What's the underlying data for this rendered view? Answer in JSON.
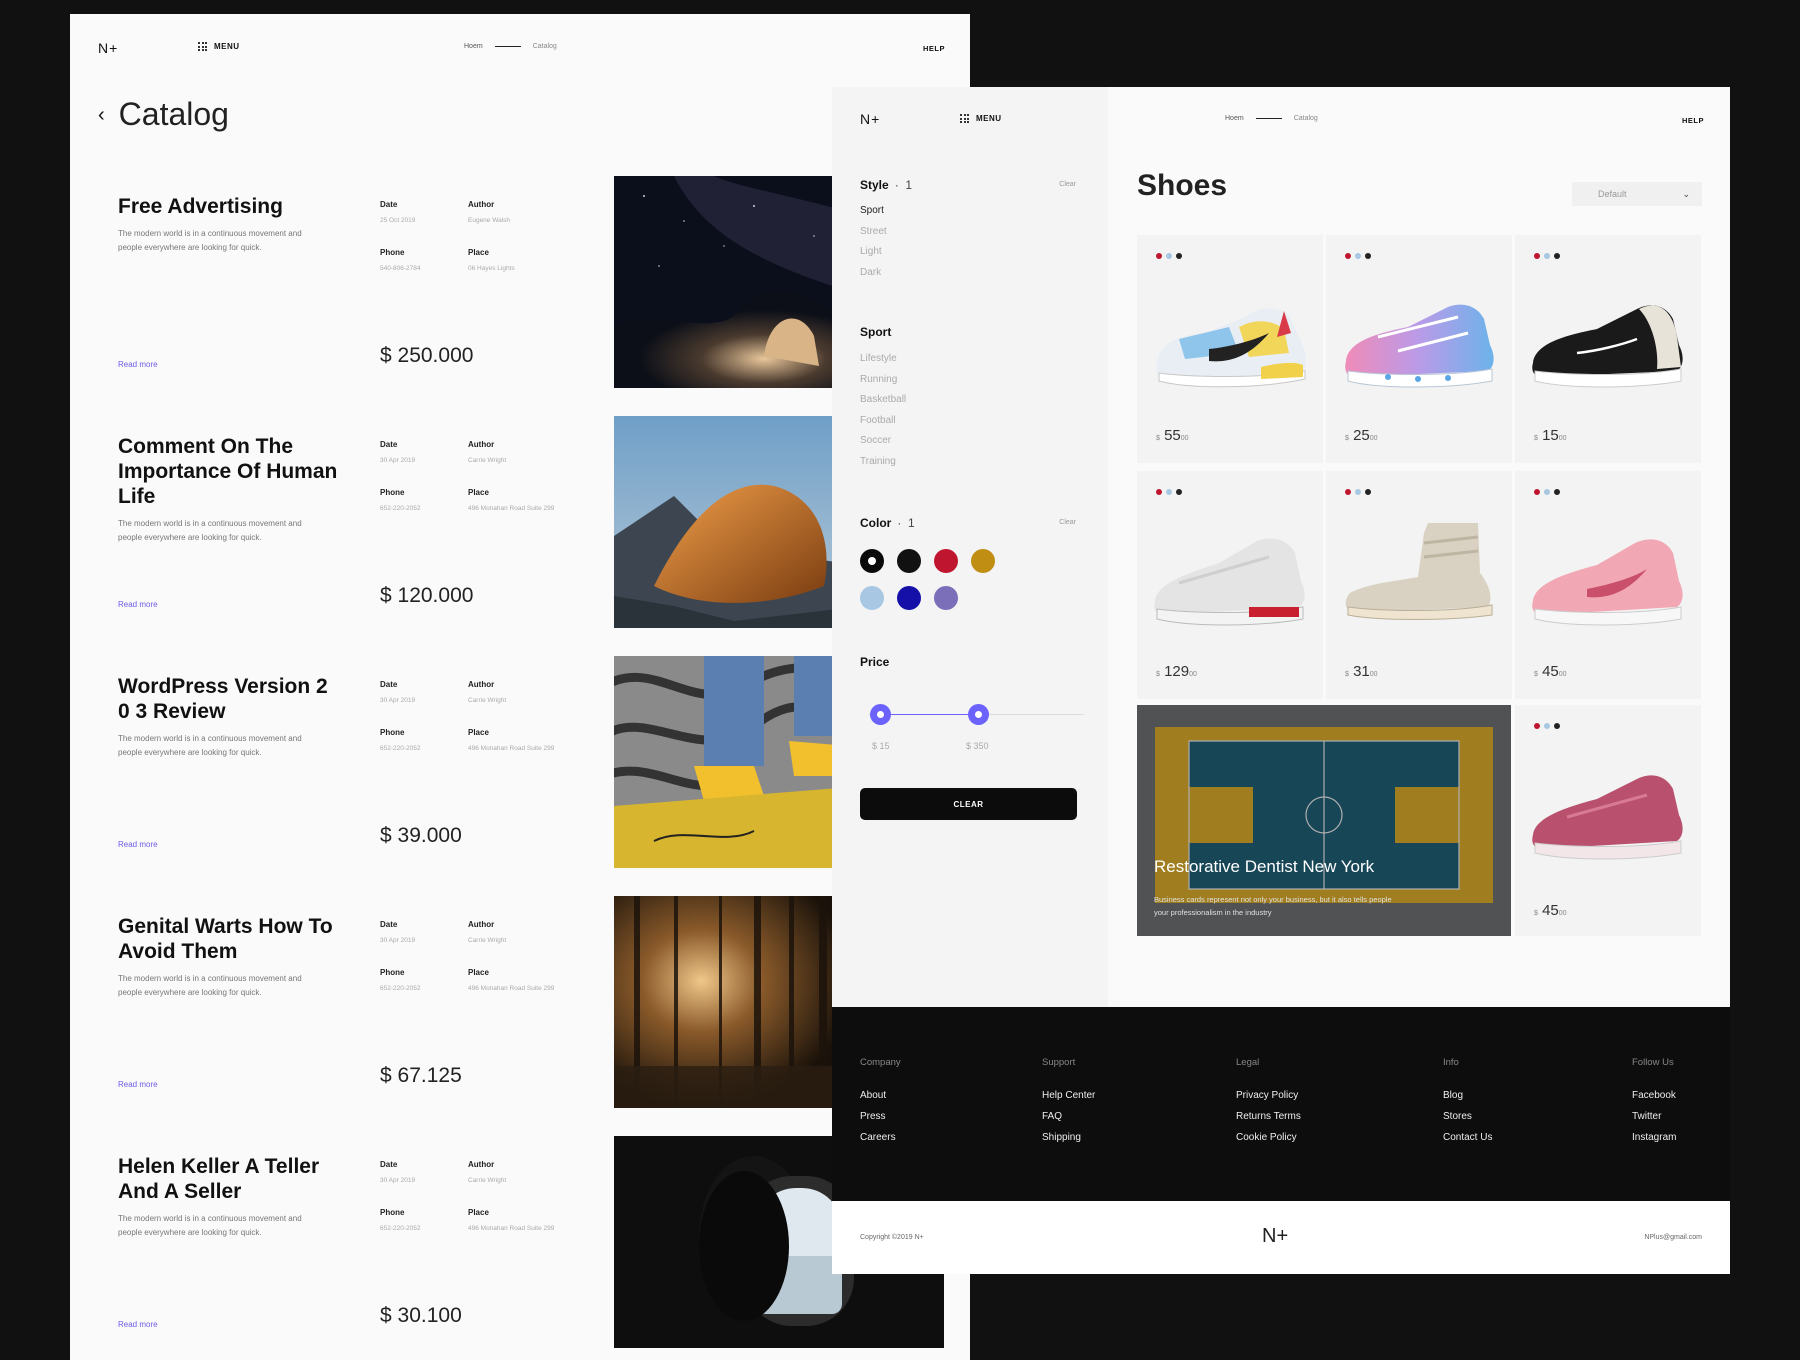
{
  "catalog": {
    "logo": "N+",
    "menu_label": "MENU",
    "breadcrumb": [
      "Hoem",
      "Catalog"
    ],
    "help": "HELP",
    "title": "Catalog",
    "items": [
      {
        "title": "Free Advertising",
        "desc": "The modern world is in a continuous movement and people everywhere are looking for quick.",
        "date_label": "Date",
        "date": "25 Oct 2019",
        "author_label": "Author",
        "author": "Eugene Walsh",
        "phone_label": "Phone",
        "phone": "540-806-2784",
        "place_label": "Place",
        "place": "06 Hayes Lights",
        "read_more": "Read more",
        "price": "$ 250.000"
      },
      {
        "title": "Comment On The Importance Of Human Life",
        "desc": "The modern world is in a continuous movement and people everywhere are looking for quick.",
        "date_label": "Date",
        "date": "30 Apr 2019",
        "author_label": "Author",
        "author": "Carrie Wright",
        "phone_label": "Phone",
        "phone": "652-220-2052",
        "place_label": "Place",
        "place": "496 Monahan Road Suite 299",
        "read_more": "Read more",
        "price": "$ 120.000"
      },
      {
        "title": "WordPress Version 2 0 3 Review",
        "desc": "The modern world is in a continuous movement and people everywhere are looking for quick.",
        "date_label": "Date",
        "date": "30 Apr 2019",
        "author_label": "Author",
        "author": "Carrie Wright",
        "phone_label": "Phone",
        "phone": "652-220-2052",
        "place_label": "Place",
        "place": "496 Monahan Road Suite 299",
        "read_more": "Read more",
        "price": "$ 39.000"
      },
      {
        "title": "Genital Warts How To Avoid Them",
        "desc": "The modern world is in a continuous movement and people everywhere are looking for quick.",
        "date_label": "Date",
        "date": "30 Apr 2019",
        "author_label": "Author",
        "author": "Carrie Wright",
        "phone_label": "Phone",
        "phone": "652-220-2052",
        "place_label": "Place",
        "place": "496 Monahan Road Suite 299",
        "read_more": "Read more",
        "price": "$ 67.125"
      },
      {
        "title": "Helen Keller A Teller And A Seller",
        "desc": "The modern world is in a continuous movement and people everywhere are looking for quick.",
        "date_label": "Date",
        "date": "30 Apr 2019",
        "author_label": "Author",
        "author": "Carrie Wright",
        "phone_label": "Phone",
        "phone": "652-220-2052",
        "place_label": "Place",
        "place": "496 Monahan Road Suite 299",
        "read_more": "Read more",
        "price": "$ 30.100"
      }
    ]
  },
  "shoes": {
    "logo": "N+",
    "menu_label": "MENU",
    "breadcrumb": [
      "Hoem",
      "Catalog"
    ],
    "help": "HELP",
    "title": "Shoes",
    "sort_value": "Default",
    "filters": {
      "style": {
        "label": "Style",
        "count": "1",
        "clear": "Clear",
        "options": [
          "Sport",
          "Street",
          "Light",
          "Dark"
        ],
        "active": "Sport"
      },
      "sport": {
        "label": "Sport",
        "options": [
          "Lifestyle",
          "Running",
          "Basketball",
          "Football",
          "Soccer",
          "Training"
        ]
      },
      "color": {
        "label": "Color",
        "count": "1",
        "clear": "Clear",
        "swatches": [
          "#0a0a0a",
          "#111111",
          "#c0152f",
          "#c08e12",
          "#a7c7e3",
          "#1410a8",
          "#7a6fb8"
        ],
        "selected": "#0a0a0a"
      },
      "price": {
        "label": "Price",
        "min": "$ 15",
        "max": "$ 350",
        "clear_label": "CLEAR"
      }
    },
    "products": [
      {
        "whole": "55",
        "cents": "00",
        "currency": "$"
      },
      {
        "whole": "25",
        "cents": "00",
        "currency": "$"
      },
      {
        "whole": "15",
        "cents": "00",
        "currency": "$"
      },
      {
        "whole": "129",
        "cents": "00",
        "currency": "$"
      },
      {
        "whole": "31",
        "cents": "00",
        "currency": "$"
      },
      {
        "whole": "45",
        "cents": "00",
        "currency": "$"
      },
      {
        "whole": "45",
        "cents": "00",
        "currency": "$"
      }
    ],
    "product_dot_colors": [
      "#c0152f",
      "#a7c7e3",
      "#222222"
    ],
    "promo": {
      "title": "Restorative Dentist New York",
      "text": "Business cards represent not only your business, but it also tells people your professionalism in the industry"
    },
    "footer": {
      "columns": [
        {
          "heading": "Company",
          "links": [
            "About",
            "Press",
            "Careers"
          ]
        },
        {
          "heading": "Support",
          "links": [
            "Help Center",
            "FAQ",
            "Shipping"
          ]
        },
        {
          "heading": "Legal",
          "links": [
            "Privacy Policy",
            "Returns Terms",
            "Cookie Policy"
          ]
        },
        {
          "heading": "Info",
          "links": [
            "Blog",
            "Stores",
            "Contact Us"
          ]
        },
        {
          "heading": "Follow Us",
          "links": [
            "Facebook",
            "Twitter",
            "Instagram"
          ]
        }
      ],
      "copyright": "Copyright ©2019 N+",
      "logo": "N+",
      "email": "NPlus@gmail.com"
    }
  }
}
